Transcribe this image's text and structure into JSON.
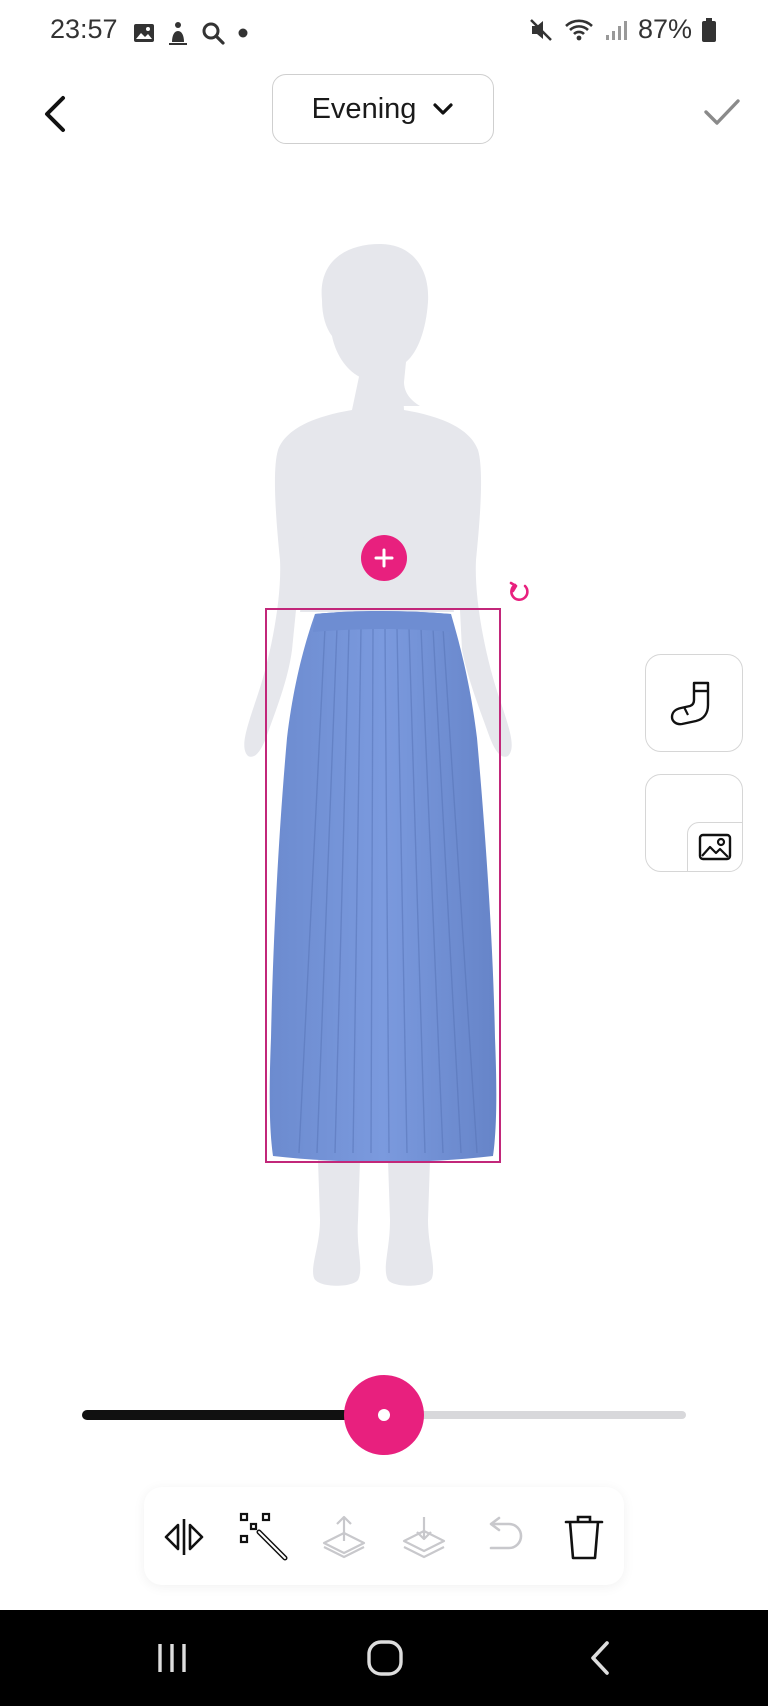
{
  "status_bar": {
    "time": "23:57",
    "battery": "87%",
    "left_icons": [
      "gallery-icon",
      "notification-icon",
      "search-icon",
      "dot-icon"
    ],
    "right_icons": [
      "mute-icon",
      "wifi-icon",
      "signal-icon",
      "battery-icon"
    ]
  },
  "header": {
    "occasion_label": "Evening",
    "back_icon": "chevron-left-icon",
    "dropdown_icon": "chevron-down-icon",
    "confirm_icon": "check-icon"
  },
  "canvas": {
    "item": "skirt",
    "add_icon": "plus-icon",
    "rotate_icon": "rotate-icon",
    "selection_color": "#c2277a"
  },
  "side_panel": {
    "items": [
      {
        "name": "sock-button",
        "icon": "sock-icon"
      },
      {
        "name": "add-photo-button",
        "icon": "image-icon"
      }
    ]
  },
  "slider": {
    "value": 0.5,
    "accent": "#e8207e"
  },
  "toolbar": {
    "tools": [
      {
        "name": "flip-button",
        "icon": "flip-horizontal-icon",
        "enabled": true
      },
      {
        "name": "magic-wand-button",
        "icon": "magic-wand-icon",
        "enabled": true
      },
      {
        "name": "bring-forward-button",
        "icon": "layer-up-icon",
        "enabled": false
      },
      {
        "name": "send-backward-button",
        "icon": "layer-down-icon",
        "enabled": false
      },
      {
        "name": "undo-button",
        "icon": "undo-icon",
        "enabled": false
      },
      {
        "name": "delete-button",
        "icon": "trash-icon",
        "enabled": true
      }
    ]
  },
  "nav_bar": {
    "buttons": [
      "recents-icon",
      "home-icon",
      "back-icon"
    ]
  },
  "colors": {
    "accent": "#e8207e",
    "skirt": "#7393d6",
    "mannequin": "#e6e7ec"
  }
}
